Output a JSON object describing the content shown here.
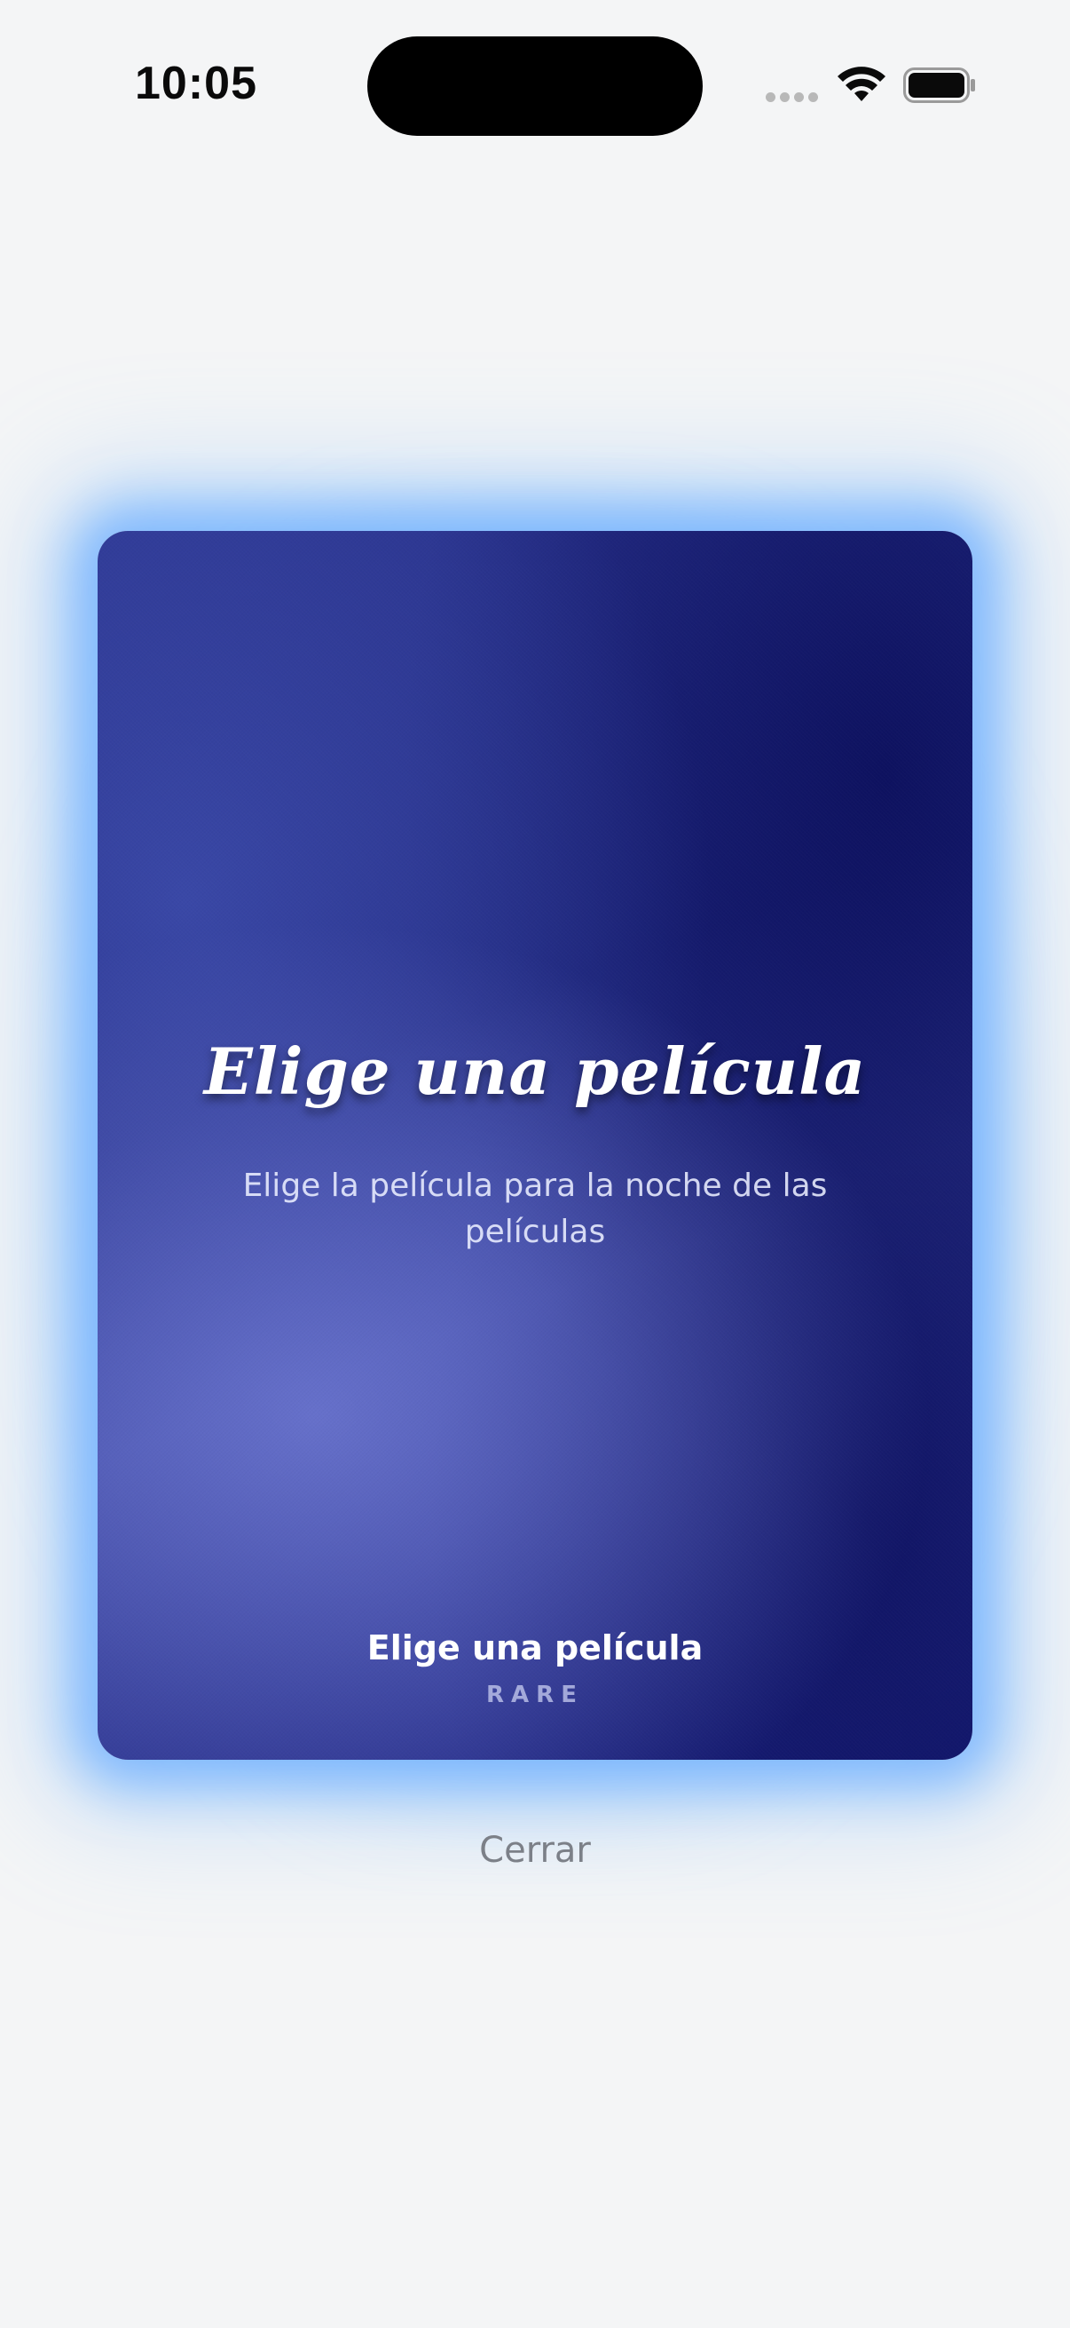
{
  "status_bar": {
    "time": "10:05"
  },
  "card": {
    "title": "Elige una película",
    "subtitle": "Elige la película para la noche de las películas",
    "footer_name": "Elige una película",
    "rarity": "RARE"
  },
  "actions": {
    "close_label": "Cerrar"
  },
  "icons": {
    "signal": "cellular-signal-icon",
    "wifi": "wifi-icon",
    "battery": "battery-icon"
  },
  "colors": {
    "glow": "#6fb4ff",
    "card_dark": "#141a74",
    "card_light": "#5560b8",
    "close_text": "#7c8088"
  }
}
